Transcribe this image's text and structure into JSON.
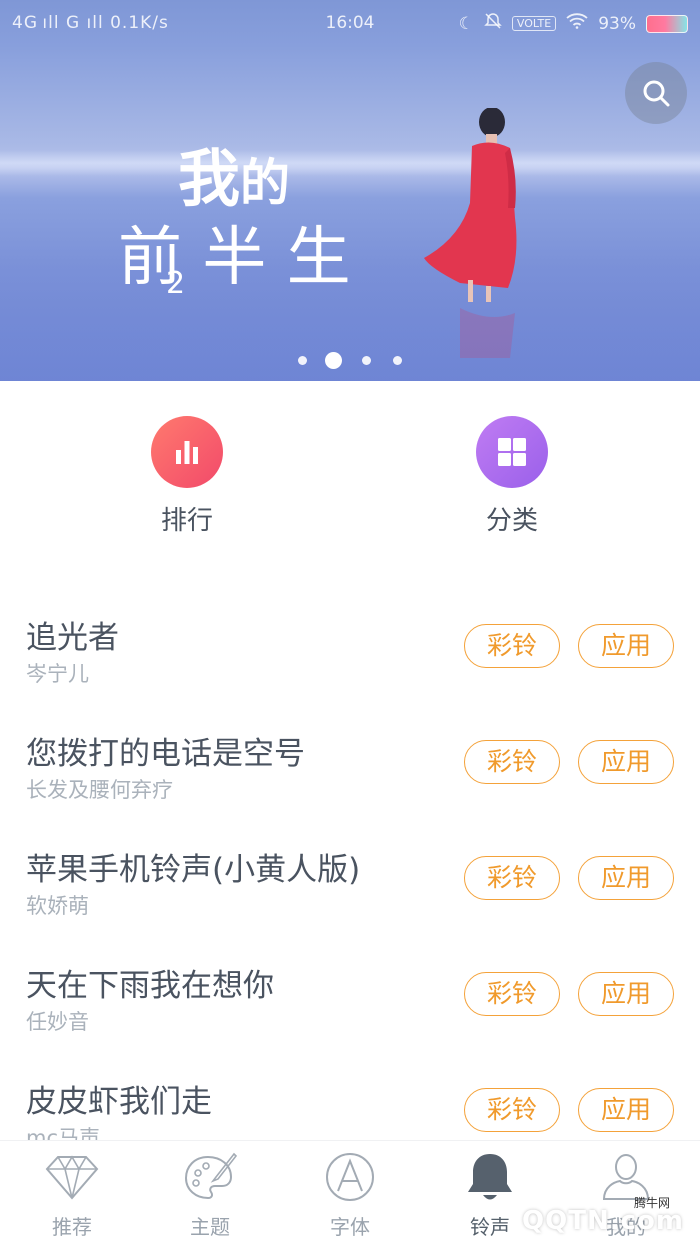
{
  "status_bar": {
    "left": "4G ıll  G ıll  0.1K/s",
    "time": "16:04",
    "volte": "VOLTE",
    "battery": "93%"
  },
  "banner": {
    "title_line1_a": "我",
    "title_line1_b": "的",
    "title_line2": "前 半 生",
    "title_sub": "2",
    "active_dot_index": 1,
    "dot_count": 4
  },
  "quick_entries": [
    {
      "label": "排行",
      "icon": "bar-chart-icon",
      "color": "#f45a6c"
    },
    {
      "label": "分类",
      "icon": "grid-icon",
      "color": "#a96cf0"
    }
  ],
  "songs": [
    {
      "title": "追光者",
      "artist": "岑宁儿"
    },
    {
      "title": "您拨打的电话是空号",
      "artist": "长发及腰何弃疗"
    },
    {
      "title": "苹果手机铃声(小黄人版)",
      "artist": "软娇萌"
    },
    {
      "title": "天在下雨我在想你",
      "artist": "任妙音"
    },
    {
      "title": "皮皮虾我们走",
      "artist": "mc马声"
    }
  ],
  "song_buttons": {
    "ring": "彩铃",
    "apply": "应用"
  },
  "bottom_nav": [
    {
      "label": "推荐",
      "icon": "diamond-icon",
      "active": false
    },
    {
      "label": "主题",
      "icon": "palette-icon",
      "active": false
    },
    {
      "label": "字体",
      "icon": "font-a-icon",
      "active": false
    },
    {
      "label": "铃声",
      "icon": "bell-icon",
      "active": true
    },
    {
      "label": "我的",
      "icon": "person-icon",
      "active": false
    }
  ],
  "watermark": {
    "small": "腾牛网",
    "main": "QQTN.com"
  },
  "colors": {
    "accent": "#f09a2c",
    "rank": "#f45a6c",
    "category": "#a96cf0",
    "text": "#4a5360",
    "subtext": "#aab2bb"
  }
}
